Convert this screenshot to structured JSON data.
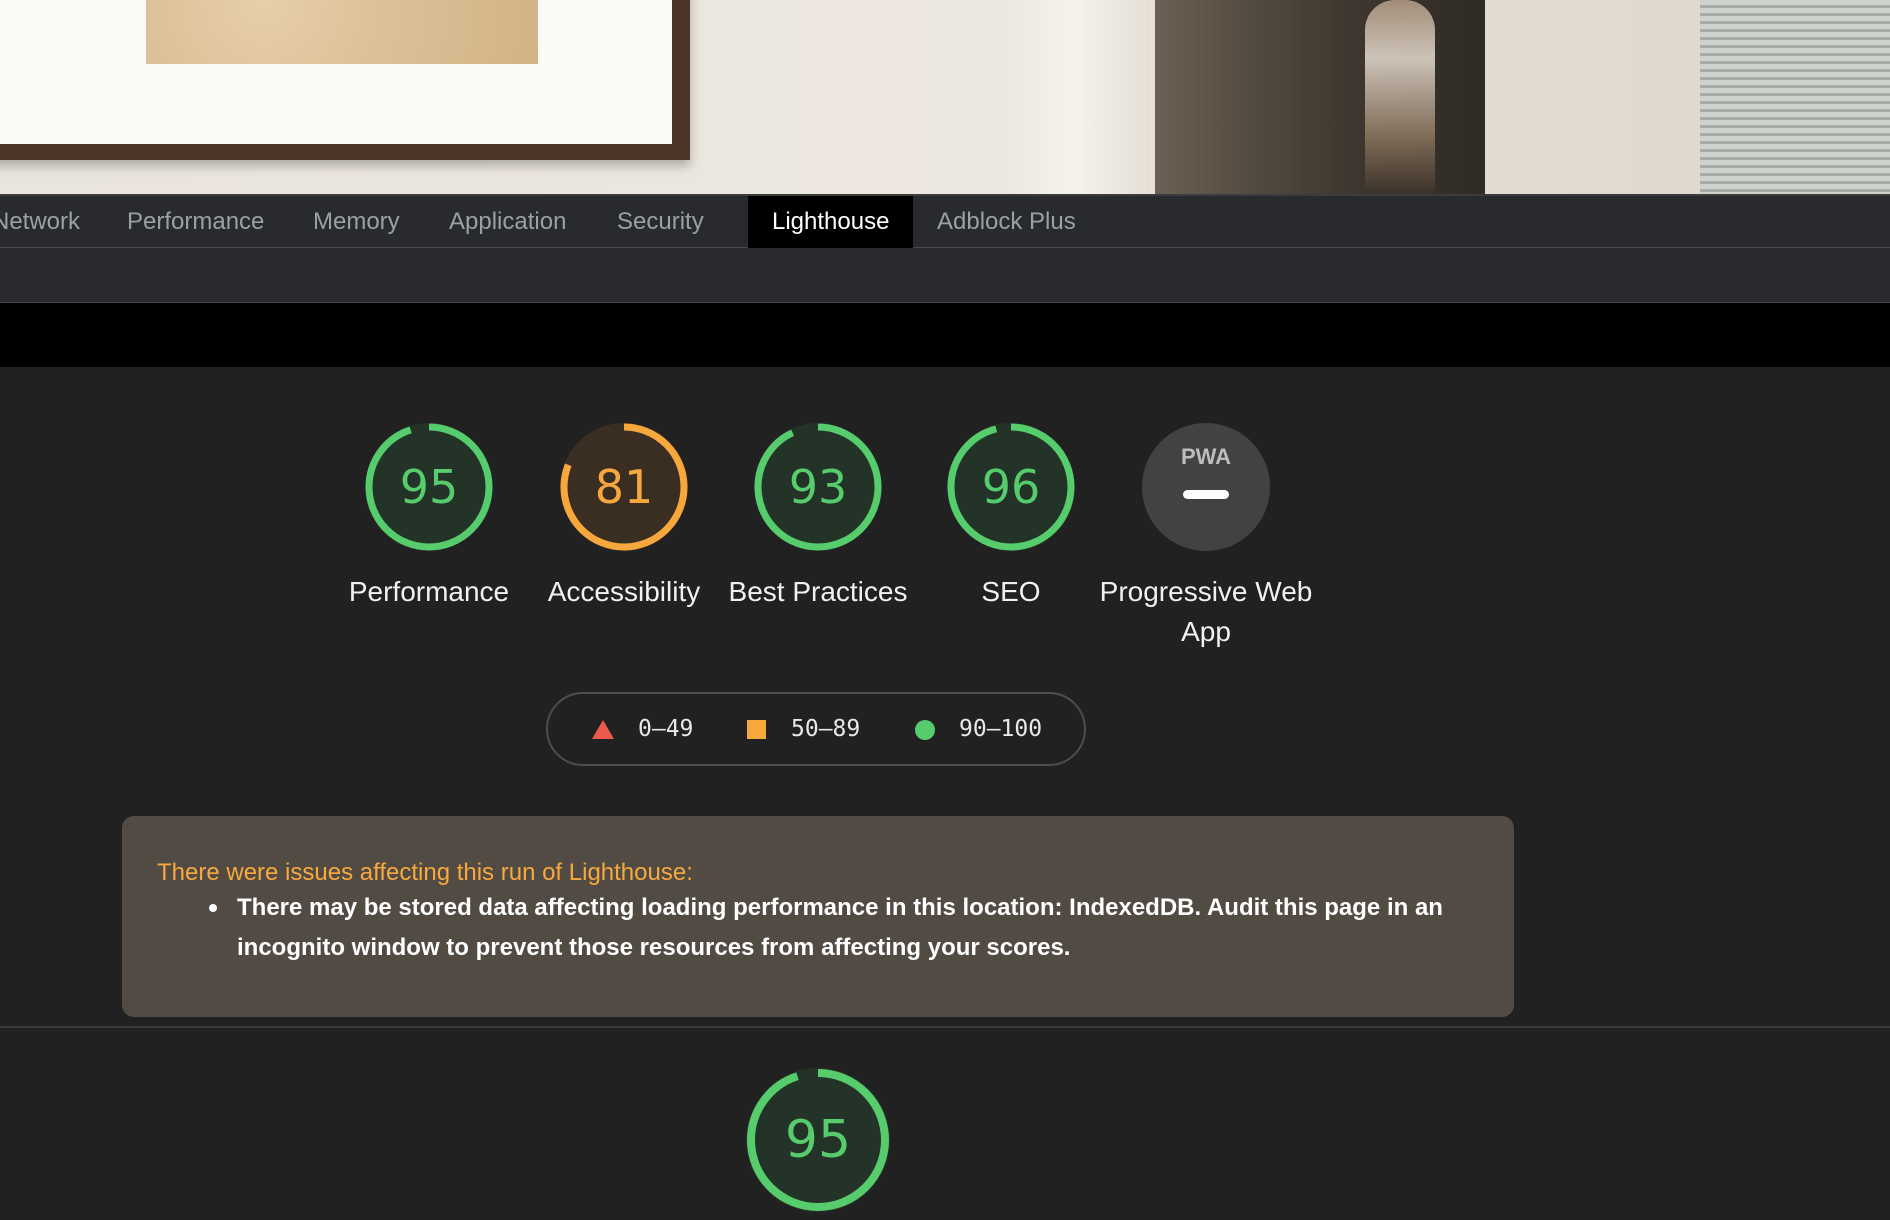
{
  "tabs": [
    {
      "label": "Network",
      "active": false
    },
    {
      "label": "Performance",
      "active": false
    },
    {
      "label": "Memory",
      "active": false
    },
    {
      "label": "Application",
      "active": false
    },
    {
      "label": "Security",
      "active": false
    },
    {
      "label": "Lighthouse",
      "active": true
    },
    {
      "label": "Adblock Plus",
      "active": false
    }
  ],
  "scores": [
    {
      "label": "Performance",
      "value": "95",
      "fraction": 0.95,
      "status": "pass"
    },
    {
      "label": "Accessibility",
      "value": "81",
      "fraction": 0.81,
      "status": "average"
    },
    {
      "label": "Best Practices",
      "value": "93",
      "fraction": 0.93,
      "status": "pass"
    },
    {
      "label": "SEO",
      "value": "96",
      "fraction": 0.96,
      "status": "pass"
    }
  ],
  "pwa": {
    "label": "Progressive Web App",
    "badge": "PWA"
  },
  "legend": [
    {
      "shape": "triangle",
      "range": "0–49",
      "color": "#eb5a4a"
    },
    {
      "shape": "square",
      "range": "50–89",
      "color": "#f6a83c"
    },
    {
      "shape": "circle",
      "range": "90–100",
      "color": "#56cc6c"
    }
  ],
  "warning": {
    "title": "There were issues affecting this run of Lighthouse:",
    "items": [
      "There may be stored data affecting loading performance in this location: IndexedDB. Audit this page in an incognito window to prevent those resources from affecting your scores."
    ]
  },
  "detail_score": {
    "value": "95",
    "fraction": 0.95,
    "status": "pass"
  },
  "colors": {
    "pass": "#56cc6c",
    "pass_bg": "#243327",
    "average": "#f6a83c",
    "average_bg": "#3a2e22",
    "pwa_bg": "#424242"
  }
}
